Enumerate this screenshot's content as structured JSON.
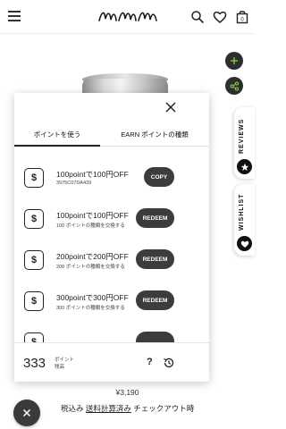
{
  "header": {
    "logo_text": "mmm",
    "icons": [
      "hamburger-menu-icon",
      "search-icon",
      "heart-icon",
      "shopping-bag-icon"
    ],
    "cart_count": "0"
  },
  "product": {
    "price": "¥3,190",
    "tax_prefix": "税込み",
    "tax_link": "送料計算済み",
    "tax_suffix": "チェックアウト時"
  },
  "side_tabs": {
    "reviews": "REVIEWS",
    "wishlist": "WISHLIST"
  },
  "popup": {
    "tabs": [
      "ポイントを使う",
      "EARN ポイントの種類"
    ],
    "active_tab": 0,
    "items": [
      {
        "title": "100pointで100円OFF",
        "subtitle": "3975C07DA439",
        "action": "COPY"
      },
      {
        "title": "100pointで100円OFF",
        "subtitle": "100 ポイントの種類を交換する",
        "action": "REDEEM"
      },
      {
        "title": "200pointで200円OFF",
        "subtitle": "200 ポイントの種類を交換する",
        "action": "REDEEM"
      },
      {
        "title": "300pointで300円OFF",
        "subtitle": "300 ポイントの種類を交換する",
        "action": "REDEEM"
      }
    ],
    "footer": {
      "points": "333",
      "points_label_1": "ポイント",
      "points_label_2": "残高",
      "help_symbol": "?"
    }
  },
  "colors": {
    "dark_button": "#3c3c3c",
    "accent_dark": "#2e2e2e",
    "background": "#ffffff"
  }
}
